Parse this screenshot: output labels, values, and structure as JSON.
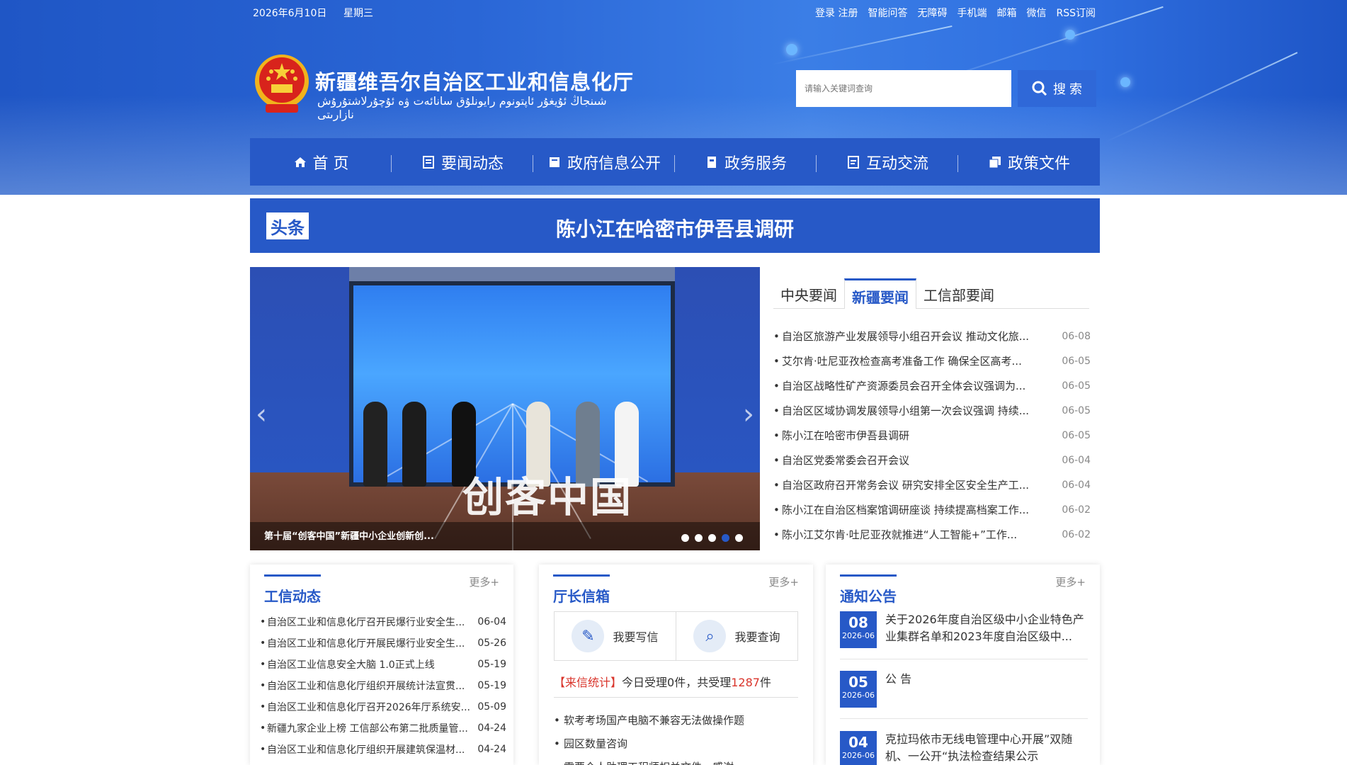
{
  "topbar": {
    "date": "2026年6月10日",
    "weekday": "星期三",
    "links": [
      "登录 注册",
      "智能问答",
      "无障碍",
      "手机端",
      "邮箱",
      "微信",
      "RSS订阅"
    ]
  },
  "header": {
    "title": "新疆维吾尔自治区工业和信息化厅",
    "subtitle": "شىنجاڭ ئۇيغۇر ئاپتونوم رايونلۇق سانائەت ۋە ئۇچۇرلاشتۇرۇش نازارىتى",
    "search_placeholder": "请输入关键词查询",
    "search_button": "搜 索"
  },
  "nav": {
    "items": [
      {
        "label": "首 页",
        "icon": "home-icon"
      },
      {
        "label": "要闻动态",
        "icon": "document-icon"
      },
      {
        "label": "政府信息公开",
        "icon": "book-icon"
      },
      {
        "label": "政务服务",
        "icon": "service-icon"
      },
      {
        "label": "互动交流",
        "icon": "chat-doc-icon"
      },
      {
        "label": "政策文件",
        "icon": "policy-icon"
      }
    ]
  },
  "headline": {
    "tag": "头条",
    "title": "陈小江在哈密市伊吾县调研"
  },
  "carousel": {
    "caption": "第十届“创客中国”新疆中小企业创新创...",
    "overlay_text": "创客中国",
    "slide_count": 5,
    "active_slide": 4
  },
  "news": {
    "tabs": [
      "中央要闻",
      "新疆要闻",
      "工信部要闻"
    ],
    "active_tab": 1,
    "items": [
      {
        "title": "自治区旅游产业发展领导小组召开会议 推动文化旅...",
        "date": "06-08"
      },
      {
        "title": "艾尔肯·吐尼亚孜检查高考准备工作 确保全区高考...",
        "date": "06-05"
      },
      {
        "title": "自治区战略性矿产资源委员会召开全体会议强调为...",
        "date": "06-05"
      },
      {
        "title": "自治区区域协调发展领导小组第一次会议强调 持续...",
        "date": "06-05"
      },
      {
        "title": "陈小江在哈密市伊吾县调研",
        "date": "06-05"
      },
      {
        "title": "自治区党委常委会召开会议",
        "date": "06-04"
      },
      {
        "title": "自治区政府召开常务会议 研究安排全区安全生产工...",
        "date": "06-04"
      },
      {
        "title": "陈小江在自治区档案馆调研座谈 持续提高档案工作...",
        "date": "06-02"
      },
      {
        "title": "陈小江艾尔肯·吐尼亚孜就推进“人工智能+”工作...",
        "date": "06-02"
      }
    ]
  },
  "panels": {
    "more_label": "更多+",
    "gongxin": {
      "title": "工信动态",
      "items": [
        {
          "title": "自治区工业和信息化厅召开民爆行业安全生...",
          "date": "06-04"
        },
        {
          "title": "自治区工业和信息化厅开展民爆行业安全生...",
          "date": "05-26"
        },
        {
          "title": "自治区工业信息安全大脑 1.0正式上线",
          "date": "05-19"
        },
        {
          "title": "自治区工业和信息化厅组织开展统计法宣贯...",
          "date": "05-19"
        },
        {
          "title": "自治区工业和信息化厅召开2026年厅系统安...",
          "date": "05-09"
        },
        {
          "title": "新疆九家企业上榜 工信部公布第二批质量管...",
          "date": "04-24"
        },
        {
          "title": "自治区工业和信息化厅组织开展建筑保温材...",
          "date": "04-24"
        }
      ]
    },
    "mailbox": {
      "title": "厅长信箱",
      "write_label": "我要写信",
      "query_label": "我要查询",
      "stat_prefix": "【来信统计】",
      "stat_text1": "今日受理",
      "today_count": "0",
      "stat_text2": "件，共受理",
      "total_count": "1287",
      "stat_text3": "件",
      "items": [
        "软考考场国产电脑不兼容无法做操作题",
        "园区数量咨询",
        "需要个人助理工程师相关文件，感谢"
      ]
    },
    "notice": {
      "title": "通知公告",
      "items": [
        {
          "day": "08",
          "ym": "2026-06",
          "title": "关于2026年度自治区级中小企业特色产业集群名单和2023年度自治区级中..."
        },
        {
          "day": "05",
          "ym": "2026-06",
          "title": "公 告"
        },
        {
          "day": "04",
          "ym": "2026-06",
          "title": "克拉玛依市无线电管理中心开展”双随机、一公开“执法检查结果公示"
        }
      ]
    }
  },
  "colors": {
    "brand_blue": "#2759c7",
    "stat_red": "#d9342b"
  }
}
